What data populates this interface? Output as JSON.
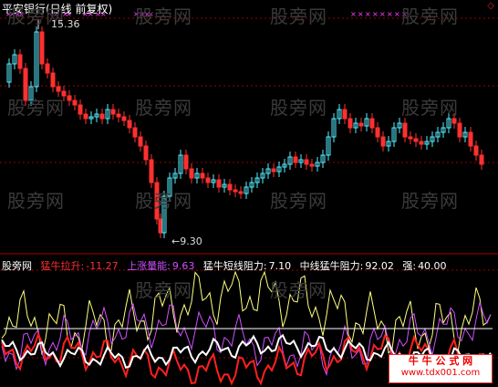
{
  "header": {
    "title": "平安银行(日线 前复权)",
    "diamond": "◇"
  },
  "price_labels": {
    "high": "15.36",
    "low": "←9.30"
  },
  "watermarks": [
    "股旁网",
    "股旁网",
    "股旁网",
    "股旁网",
    "股旁网",
    "股旁网",
    "股旁网",
    "股旁网",
    "股旁网",
    "股旁网",
    "股旁网",
    "股旁网",
    "股旁网",
    "股旁网"
  ],
  "indicator": {
    "name": "股旁网",
    "items": [
      {
        "label": "猛牛拉升:",
        "value": "-11.27",
        "color": "#ff3030"
      },
      {
        "label": "上涨量能:",
        "value": "9.63",
        "color": "#d050ff"
      },
      {
        "label": "猛牛短线阻力:",
        "value": "7.10",
        "color": "#ffffff"
      },
      {
        "label": "中线猛牛阻力:",
        "value": "92.02",
        "color": "#ffffff"
      },
      {
        "label": "强:",
        "value": "40.00",
        "color": "#ffffff"
      }
    ]
  },
  "stamp": {
    "line1": "牛 牛 公 式 网",
    "line2": "www.tdx001.com"
  },
  "colors": {
    "up": "#55eeff",
    "down": "#ff3030",
    "grid": "#990000",
    "markers": "#ff40ff"
  }
}
